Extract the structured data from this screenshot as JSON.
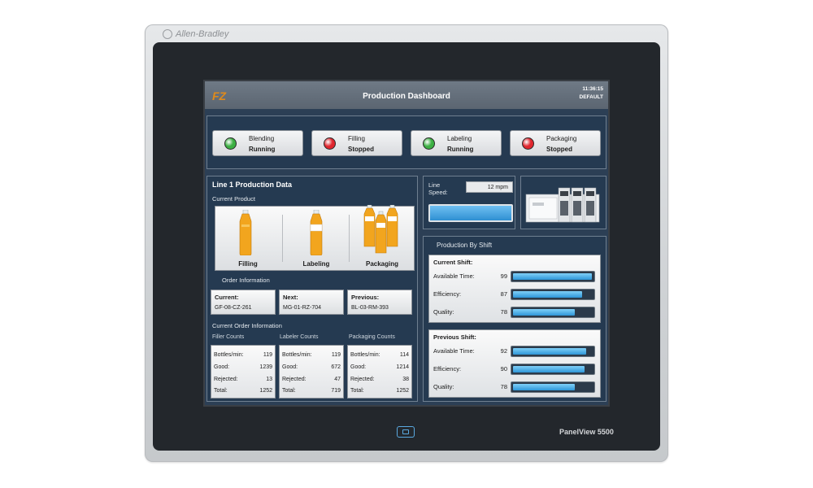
{
  "device": {
    "brand": "Allen-Bradley",
    "model": "PanelView 5500"
  },
  "header": {
    "logo": "FZ",
    "title": "Production Dashboard",
    "time": "11:36:15",
    "user": "DEFAULT"
  },
  "status_buttons": [
    {
      "name": "Blending",
      "state": "Running",
      "lamp": "#3cb043"
    },
    {
      "name": "Filling",
      "state": "Stopped",
      "lamp": "#e0262e"
    },
    {
      "name": "Labeling",
      "state": "Running",
      "lamp": "#3cb043"
    },
    {
      "name": "Packaging",
      "state": "Stopped",
      "lamp": "#e0262e"
    }
  ],
  "line_panel": {
    "title": "Line 1 Production Data",
    "current_product_label": "Current Product",
    "product_stages": [
      "Filling",
      "Labeling",
      "Packaging"
    ],
    "order_information_label": "Order Information",
    "orders": [
      {
        "head": "Current:",
        "value": "GF-08-CZ-261"
      },
      {
        "head": "Next:",
        "value": "MG-01-RZ-704"
      },
      {
        "head": "Previous:",
        "value": "BL-03-RM-393"
      }
    ],
    "current_order_label": "Current Order Information",
    "counts": [
      {
        "head": "Filler Counts",
        "rows": [
          [
            "Bottles/min:",
            "119"
          ],
          [
            "Good:",
            "1239"
          ],
          [
            "Rejected:",
            "13"
          ],
          [
            "Total:",
            "1252"
          ]
        ]
      },
      {
        "head": "Labeler Counts",
        "rows": [
          [
            "Bottles/min:",
            "119"
          ],
          [
            "Good:",
            "672"
          ],
          [
            "Rejected:",
            "47"
          ],
          [
            "Total:",
            "719"
          ]
        ]
      },
      {
        "head": "Packaging Counts",
        "rows": [
          [
            "Bottles/min:",
            "114"
          ],
          [
            "Good:",
            "1214"
          ],
          [
            "Rejected:",
            "38"
          ],
          [
            "Total:",
            "1252"
          ]
        ]
      }
    ]
  },
  "line_speed": {
    "label": "Line Speed:",
    "value": "12 mpm"
  },
  "shift_panel": {
    "title": "Production By Shift",
    "shifts": [
      {
        "head": "Current Shift:",
        "metrics": [
          {
            "label": "Available Time:",
            "value": "99"
          },
          {
            "label": "Efficiency:",
            "value": "87"
          },
          {
            "label": "Quality:",
            "value": "78"
          }
        ]
      },
      {
        "head": "Previous Shift:",
        "metrics": [
          {
            "label": "Available Time:",
            "value": "92"
          },
          {
            "label": "Efficiency:",
            "value": "90"
          },
          {
            "label": "Quality:",
            "value": "78"
          }
        ]
      }
    ]
  },
  "colors": {
    "accent": "#2f8fd2",
    "panel": "#253a51",
    "running": "#3cb043",
    "stopped": "#e0262e"
  }
}
